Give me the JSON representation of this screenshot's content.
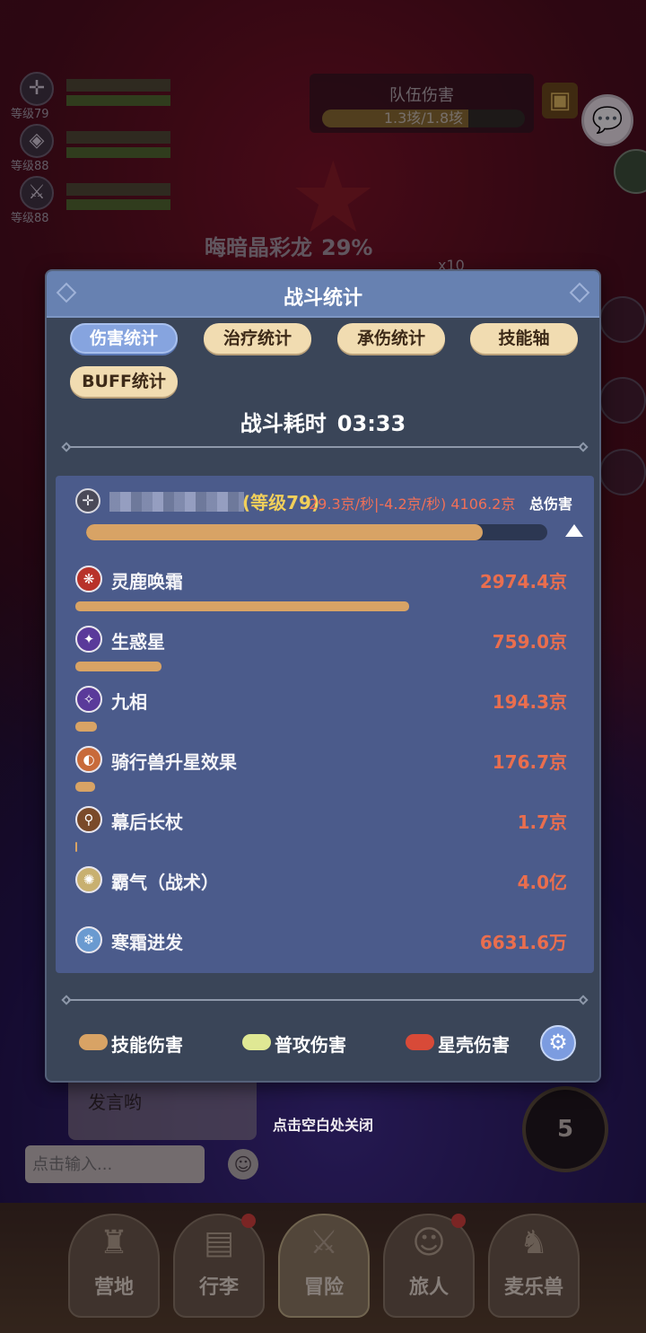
{
  "background": {
    "party": [
      {
        "level": "等级79",
        "emblem_icon": "crosshair-icon"
      },
      {
        "level": "等级88",
        "emblem_icon": "rune-icon"
      },
      {
        "level": "等级88",
        "emblem_icon": "sword-icon"
      }
    ],
    "team_damage": {
      "title": "队伍伤害",
      "value": "1.3垓/1.8垓",
      "progress": 0.72
    },
    "boss": {
      "name": "晦暗晶彩龙",
      "hp_percent": "29%",
      "multiplier": "x10"
    },
    "chat_draft_partial": "发言哟",
    "close_hint": "点击空白处关闭",
    "chat_input_placeholder": "点击输入...",
    "round_counter": "5",
    "nav": [
      {
        "label": "营地",
        "icon": "castle-icon",
        "badge": false,
        "active": false
      },
      {
        "label": "行李",
        "icon": "backpack-icon",
        "badge": true,
        "active": false
      },
      {
        "label": "冒险",
        "icon": "crossed-swords-icon",
        "badge": false,
        "active": true
      },
      {
        "label": "旅人",
        "icon": "traveler-icon",
        "badge": true,
        "active": false
      },
      {
        "label": "麦乐兽",
        "icon": "fox-icon",
        "badge": false,
        "active": false
      }
    ]
  },
  "modal": {
    "title": "战斗统计",
    "tabs": [
      {
        "label": "伤害统计",
        "active": true
      },
      {
        "label": "治疗统计",
        "active": false
      },
      {
        "label": "承伤统计",
        "active": false
      },
      {
        "label": "技能轴",
        "active": false
      },
      {
        "label": "BUFF统计",
        "active": false
      }
    ],
    "duration_label": "战斗耗时",
    "duration": "03:33",
    "player": {
      "level": "(等级79)",
      "dps": "29.3京/秒|-4.2京/秒)",
      "total": "4106.2京",
      "total_label": "总伤害",
      "share": 0.86
    },
    "skills": [
      {
        "name": "灵鹿唤霜",
        "value": "2974.4京",
        "share": 0.72,
        "icon": "frost-deer-icon",
        "icon_color": "#b8322a"
      },
      {
        "name": "生惑星",
        "value": "759.0京",
        "share": 0.185,
        "icon": "star-wing-icon",
        "icon_color": "#5a3a9a"
      },
      {
        "name": "九相",
        "value": "194.3京",
        "share": 0.047,
        "icon": "nine-phase-icon",
        "icon_color": "#5a3a9a"
      },
      {
        "name": "骑行兽升星效果",
        "value": "176.7京",
        "share": 0.043,
        "icon": "mount-star-icon",
        "icon_color": "#c86a3a"
      },
      {
        "name": "幕后长杖",
        "value": "1.7京",
        "share": 0.0,
        "icon": "staff-icon",
        "icon_color": "#7a4a2a"
      },
      {
        "name": "霸气（战术）",
        "value": "4.0亿",
        "share": null,
        "icon": "domineer-icon",
        "icon_color": "#c8b070"
      },
      {
        "name": "寒霜进发",
        "value": "6631.6万",
        "share": null,
        "icon": "snowflake-icon",
        "icon_color": "#6a9ad0"
      }
    ],
    "legend": [
      {
        "label": "技能伤害",
        "color": "#d8a365"
      },
      {
        "label": "普攻伤害",
        "color": "#dfe894"
      },
      {
        "label": "星壳伤害",
        "color": "#d84a38"
      }
    ],
    "colors": {
      "header": "#6781b1",
      "panel": "#4b5b8b",
      "damage_value": "#ea6e4e",
      "level": "#f1cf5a"
    }
  }
}
